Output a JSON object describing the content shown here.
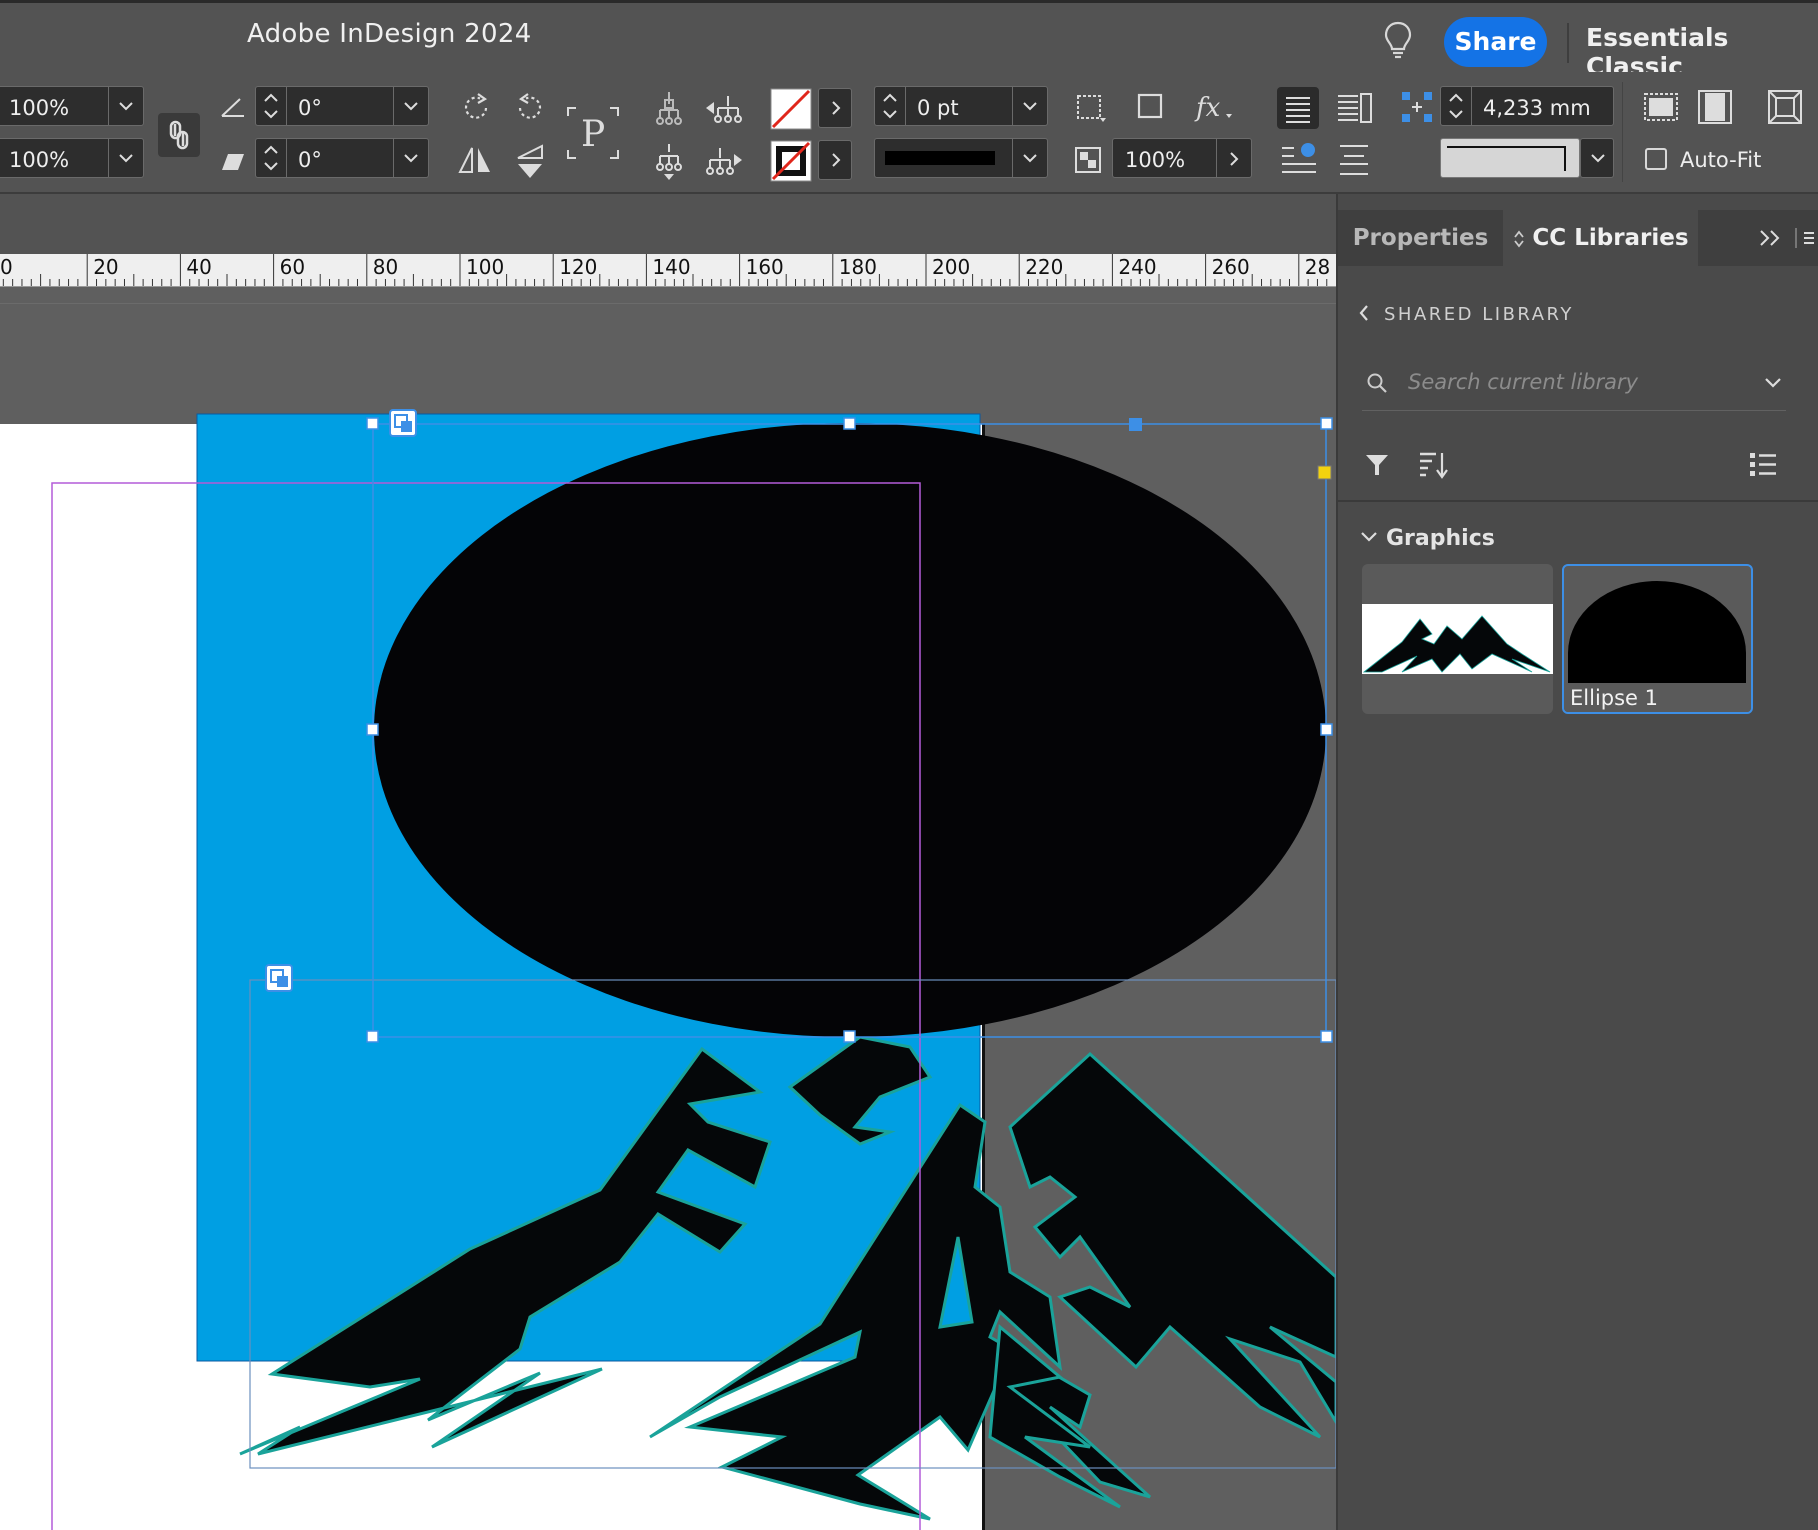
{
  "window": {
    "app_title": "Adobe InDesign 2024",
    "share_label": "Share",
    "workspace_label": "Essentials Classic"
  },
  "control_panel": {
    "scale_x": "100%",
    "scale_y": "100%",
    "rotation_angle": "0°",
    "shear_angle": "0°",
    "stroke_weight": "0 pt",
    "opacity": "100%",
    "gap_value": "4,233 mm",
    "autofit_label": "Auto-Fit",
    "autofit_checked": false
  },
  "ruler": {
    "labels": [
      "0",
      "20",
      "40",
      "60",
      "80",
      "100",
      "120",
      "140",
      "160",
      "180",
      "200",
      "220",
      "240",
      "260",
      "28"
    ]
  },
  "panel": {
    "tabs": [
      {
        "label": "Properties",
        "active": false
      },
      {
        "label": "CC Libraries",
        "active": true
      }
    ],
    "back_label": "SHARED LIBRARY",
    "search_placeholder": "Search current library",
    "section_title": "Graphics",
    "items": [
      {
        "label": "",
        "icon": "mountains-thumbnail",
        "selected": false
      },
      {
        "label": "Ellipse 1",
        "icon": "ellipse-thumbnail",
        "selected": true
      }
    ]
  },
  "colors": {
    "accent_blue": "#1473e6",
    "artwork_blue": "#009fe3",
    "mountain_outline": "#1aa39a",
    "selection_blue": "#3d8fe6",
    "margin_magenta": "#b45cd8"
  }
}
